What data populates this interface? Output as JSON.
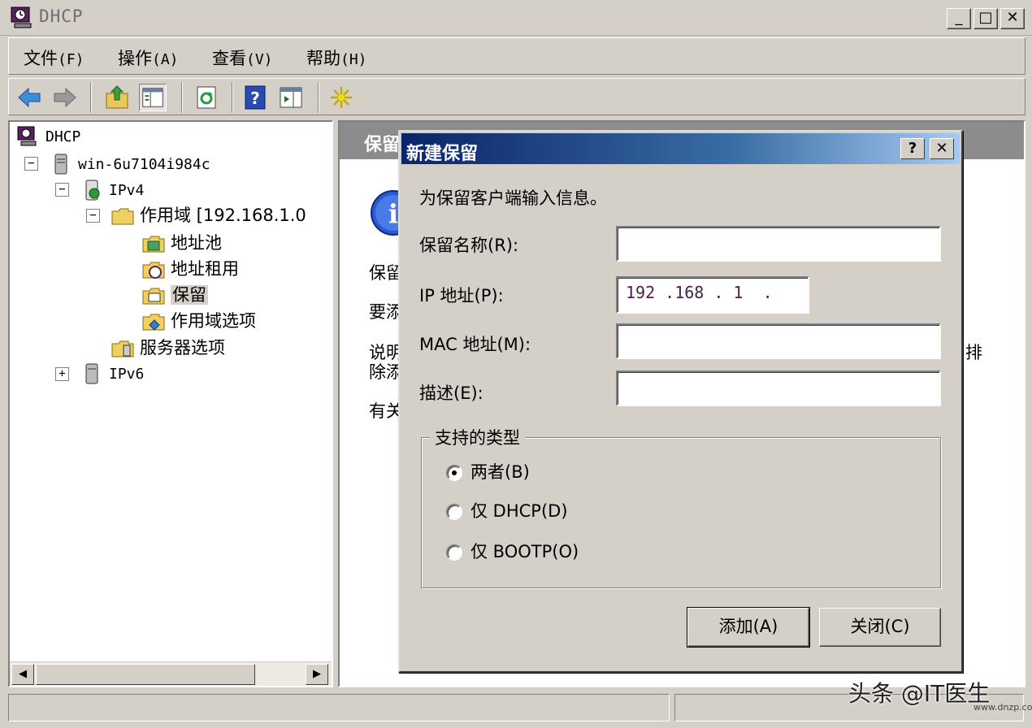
{
  "window": {
    "title": "DHCP",
    "min_label": "_",
    "max_label": "□",
    "close_label": "✕"
  },
  "menu": [
    {
      "label": "文件",
      "accel": "(F)"
    },
    {
      "label": "操作",
      "accel": "(A)"
    },
    {
      "label": "查看",
      "accel": "(V)"
    },
    {
      "label": "帮助",
      "accel": "(H)"
    }
  ],
  "toolbar": [
    "back-icon",
    "forward-icon",
    "up-folder-icon",
    "show-tree-icon",
    "refresh-icon",
    "help-icon",
    "action-pane-icon",
    "star-icon"
  ],
  "tree": {
    "root": "DHCP",
    "server": "win-6u7104i984c",
    "ipv4": "IPv4",
    "scope": "作用域 [192.168.1.0",
    "pool": "地址池",
    "leases": "地址租用",
    "reservations": "保留",
    "scope_options": "作用域选项",
    "server_options": "服务器选项",
    "ipv6": "IPv6",
    "collapse": "−",
    "expand": "+"
  },
  "right_pane": {
    "header": "保留",
    "lines": [
      "保留",
      "要添",
      "说明",
      "除添",
      "有关"
    ],
    "cut_char": "排"
  },
  "dialog": {
    "title": "新建保留",
    "help_label": "?",
    "close_label": "✕",
    "prompt": "为保留客户端输入信息。",
    "fields": {
      "name_label": "保留名称(R):",
      "name_value": "",
      "ip_label": "IP 地址(P):",
      "ip_value": "192 .168 . 1  .",
      "mac_label": "MAC 地址(M):",
      "mac_value": "",
      "desc_label": "描述(E):",
      "desc_value": ""
    },
    "group_label": "支持的类型",
    "options": [
      {
        "label": "两者(B)",
        "selected": true
      },
      {
        "label": "仅 DHCP(D)",
        "selected": false
      },
      {
        "label": "仅 BOOTP(O)",
        "selected": false
      }
    ],
    "add_button": "添加(A)",
    "close_button": "关闭(C)"
  },
  "watermark": {
    "text": "头条 @IT医生",
    "sub": "www.dnzp.com"
  },
  "colors": {
    "face": "#d4d0c8",
    "title_gradient_start": "#0a246a",
    "title_gradient_end": "#a6caf0",
    "pane_header": "#8c8c8c"
  }
}
